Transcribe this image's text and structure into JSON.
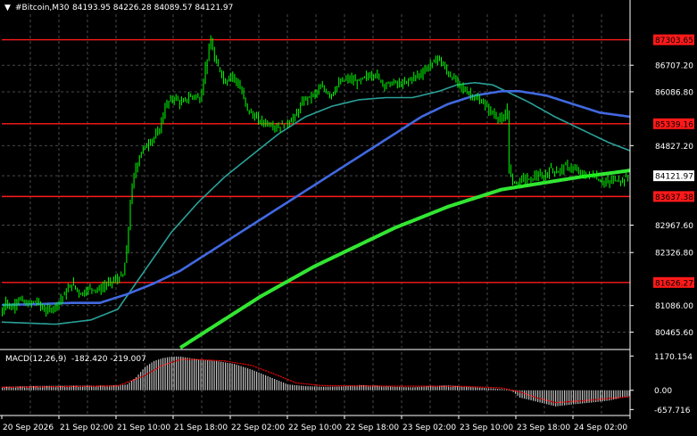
{
  "header": {
    "menu_arrow": "▼",
    "title": "#Bitcoin,M30",
    "ohlc": "84193.95 84226.28 84089.57 84121.97"
  },
  "chart_data": [
    {
      "type": "candlestick",
      "symbol": "#Bitcoin",
      "timeframe": "M30",
      "ylim": [
        80100,
        87900
      ],
      "y_ticks": [
        87303.65,
        86707.2,
        86086.8,
        85339.16,
        84827.2,
        84121.97,
        83637.38,
        82967.6,
        82326.8,
        81626.27,
        81086.0,
        80465.6
      ],
      "y_tick_labels": [
        "87303.65",
        "86707.20",
        "86086.80",
        "85339.16",
        "84827.20",
        "84121.97",
        "83637.38",
        "82967.60",
        "82326.80",
        "81626.27",
        "81086.00",
        "80465.60"
      ],
      "x_tick_labels": [
        "20 Sep 2026",
        "21 Sep 02:00",
        "21 Sep 10:00",
        "21 Sep 18:00",
        "22 Sep 02:00",
        "22 Sep 10:00",
        "22 Sep 18:00",
        "23 Sep 02:00",
        "23 Sep 10:00",
        "23 Sep 18:00",
        "24 Sep 02:00"
      ],
      "grid": true,
      "colors": {
        "background": "#000000",
        "grid": "#4a4a4a",
        "candles": "#00ff00",
        "ma_fast": "#2aa198",
        "ma_mid": "#4169e1",
        "ma_slow": "#32e632",
        "levels": "#ff1a1a",
        "price_label_bg": "#ffffff"
      },
      "horizontal_levels": [
        {
          "value": 87303.65,
          "label": "87303.65"
        },
        {
          "value": 85339.16,
          "label": "85339.16"
        },
        {
          "value": 83637.38,
          "label": "83637.38"
        },
        {
          "value": 81626.27,
          "label": "81626.27"
        }
      ],
      "last_price": {
        "value": 84121.97,
        "label": "84121.97"
      },
      "price_path": [
        [
          0,
          80850
        ],
        [
          6,
          81200
        ],
        [
          12,
          81000
        ],
        [
          20,
          81250
        ],
        [
          30,
          81100
        ],
        [
          40,
          81200
        ],
        [
          50,
          80950
        ],
        [
          60,
          81050
        ],
        [
          70,
          81300
        ],
        [
          80,
          81600
        ],
        [
          90,
          81350
        ],
        [
          100,
          81500
        ],
        [
          110,
          81450
        ],
        [
          120,
          81600
        ],
        [
          130,
          81700
        ],
        [
          138,
          81800
        ],
        [
          142,
          82500
        ],
        [
          146,
          83600
        ],
        [
          150,
          84200
        ],
        [
          158,
          84700
        ],
        [
          166,
          84900
        ],
        [
          172,
          85000
        ],
        [
          178,
          85200
        ],
        [
          184,
          85700
        ],
        [
          190,
          85900
        ],
        [
          196,
          85950
        ],
        [
          202,
          85800
        ],
        [
          210,
          85950
        ],
        [
          218,
          86000
        ],
        [
          224,
          85900
        ],
        [
          230,
          86700
        ],
        [
          236,
          87300
        ],
        [
          240,
          86800
        ],
        [
          246,
          86600
        ],
        [
          252,
          86300
        ],
        [
          258,
          86500
        ],
        [
          264,
          86350
        ],
        [
          270,
          86100
        ],
        [
          276,
          85700
        ],
        [
          282,
          85550
        ],
        [
          290,
          85400
        ],
        [
          300,
          85350
        ],
        [
          310,
          85250
        ],
        [
          320,
          85350
        ],
        [
          330,
          85500
        ],
        [
          340,
          85900
        ],
        [
          350,
          86000
        ],
        [
          360,
          86200
        ],
        [
          370,
          86000
        ],
        [
          380,
          86300
        ],
        [
          390,
          86400
        ],
        [
          400,
          86300
        ],
        [
          410,
          86450
        ],
        [
          420,
          86500
        ],
        [
          430,
          86250
        ],
        [
          440,
          86300
        ],
        [
          450,
          86250
        ],
        [
          460,
          86400
        ],
        [
          470,
          86500
        ],
        [
          478,
          86650
        ],
        [
          484,
          86750
        ],
        [
          490,
          86900
        ],
        [
          496,
          86700
        ],
        [
          502,
          86500
        ],
        [
          510,
          86350
        ],
        [
          516,
          86200
        ],
        [
          522,
          86100
        ],
        [
          528,
          86000
        ],
        [
          534,
          85900
        ],
        [
          540,
          85850
        ],
        [
          548,
          85650
        ],
        [
          556,
          85500
        ],
        [
          564,
          85400
        ],
        [
          568,
          85700
        ],
        [
          570,
          84200
        ],
        [
          574,
          84000
        ],
        [
          580,
          83950
        ],
        [
          586,
          84100
        ],
        [
          592,
          84000
        ],
        [
          600,
          84150
        ],
        [
          608,
          84050
        ],
        [
          616,
          84300
        ],
        [
          624,
          84200
        ],
        [
          632,
          84350
        ],
        [
          640,
          84300
        ],
        [
          648,
          84200
        ],
        [
          656,
          84100
        ],
        [
          664,
          84150
        ],
        [
          672,
          84000
        ],
        [
          680,
          83950
        ],
        [
          688,
          84050
        ],
        [
          696,
          84000
        ],
        [
          705,
          84121.97
        ]
      ],
      "ma_fast_path": [
        [
          0,
          80700
        ],
        [
          60,
          80650
        ],
        [
          100,
          80750
        ],
        [
          130,
          81000
        ],
        [
          160,
          81900
        ],
        [
          190,
          82800
        ],
        [
          220,
          83500
        ],
        [
          250,
          84100
        ],
        [
          280,
          84600
        ],
        [
          310,
          85100
        ],
        [
          340,
          85500
        ],
        [
          370,
          85750
        ],
        [
          400,
          85900
        ],
        [
          430,
          85950
        ],
        [
          460,
          85950
        ],
        [
          490,
          86100
        ],
        [
          510,
          86250
        ],
        [
          530,
          86300
        ],
        [
          550,
          86250
        ],
        [
          570,
          86050
        ],
        [
          590,
          85850
        ],
        [
          620,
          85500
        ],
        [
          650,
          85200
        ],
        [
          680,
          84900
        ],
        [
          705,
          84700
        ]
      ],
      "ma_mid_path": [
        [
          0,
          81100
        ],
        [
          40,
          81120
        ],
        [
          80,
          81150
        ],
        [
          110,
          81150
        ],
        [
          140,
          81350
        ],
        [
          170,
          81600
        ],
        [
          200,
          81900
        ],
        [
          230,
          82300
        ],
        [
          260,
          82700
        ],
        [
          290,
          83100
        ],
        [
          320,
          83500
        ],
        [
          350,
          83900
        ],
        [
          380,
          84300
        ],
        [
          410,
          84700
        ],
        [
          440,
          85100
        ],
        [
          470,
          85500
        ],
        [
          500,
          85800
        ],
        [
          530,
          86000
        ],
        [
          560,
          86100
        ],
        [
          580,
          86100
        ],
        [
          610,
          86000
        ],
        [
          640,
          85800
        ],
        [
          670,
          85600
        ],
        [
          705,
          85500
        ]
      ],
      "ma_slow_path": [
        [
          200,
          80100
        ],
        [
          230,
          80500
        ],
        [
          260,
          80900
        ],
        [
          290,
          81300
        ],
        [
          320,
          81650
        ],
        [
          350,
          82000
        ],
        [
          380,
          82300
        ],
        [
          410,
          82600
        ],
        [
          440,
          82900
        ],
        [
          470,
          83150
        ],
        [
          500,
          83400
        ],
        [
          530,
          83600
        ],
        [
          560,
          83800
        ],
        [
          590,
          83900
        ],
        [
          620,
          84000
        ],
        [
          650,
          84100
        ],
        [
          680,
          84180
        ],
        [
          705,
          84250
        ]
      ]
    },
    {
      "type": "bar",
      "name": "MACD",
      "label": "MACD(12,26,9)",
      "values_text": "-182.420 -219.007",
      "ylim": [
        -800,
        1300
      ],
      "y_ticks": [
        1170.154,
        0.0,
        -657.716
      ],
      "y_tick_labels": [
        "1170.154",
        "0.00",
        "-657.716"
      ],
      "colors": {
        "histogram": "#c0c0c0",
        "signal": "#ff0000"
      },
      "histogram_path": [
        [
          0,
          120
        ],
        [
          40,
          150
        ],
        [
          80,
          160
        ],
        [
          110,
          160
        ],
        [
          130,
          170
        ],
        [
          140,
          200
        ],
        [
          150,
          450
        ],
        [
          160,
          800
        ],
        [
          170,
          1000
        ],
        [
          180,
          1100
        ],
        [
          190,
          1150
        ],
        [
          200,
          1150
        ],
        [
          210,
          1100
        ],
        [
          220,
          1050
        ],
        [
          240,
          1000
        ],
        [
          260,
          900
        ],
        [
          280,
          700
        ],
        [
          300,
          450
        ],
        [
          320,
          200
        ],
        [
          340,
          140
        ],
        [
          360,
          120
        ],
        [
          380,
          130
        ],
        [
          400,
          180
        ],
        [
          420,
          160
        ],
        [
          440,
          120
        ],
        [
          460,
          100
        ],
        [
          480,
          150
        ],
        [
          500,
          170
        ],
        [
          520,
          120
        ],
        [
          540,
          80
        ],
        [
          560,
          40
        ],
        [
          570,
          0
        ],
        [
          580,
          -250
        ],
        [
          600,
          -400
        ],
        [
          620,
          -550
        ],
        [
          640,
          -480
        ],
        [
          660,
          -420
        ],
        [
          680,
          -350
        ],
        [
          705,
          -182
        ]
      ],
      "signal_path": [
        [
          0,
          100
        ],
        [
          80,
          130
        ],
        [
          130,
          150
        ],
        [
          160,
          500
        ],
        [
          180,
          850
        ],
        [
          200,
          1050
        ],
        [
          220,
          1050
        ],
        [
          250,
          1000
        ],
        [
          280,
          850
        ],
        [
          310,
          500
        ],
        [
          330,
          250
        ],
        [
          360,
          160
        ],
        [
          400,
          150
        ],
        [
          440,
          140
        ],
        [
          480,
          140
        ],
        [
          520,
          130
        ],
        [
          560,
          80
        ],
        [
          580,
          -50
        ],
        [
          600,
          -260
        ],
        [
          620,
          -420
        ],
        [
          650,
          -360
        ],
        [
          680,
          -280
        ],
        [
          705,
          -219
        ]
      ]
    }
  ]
}
